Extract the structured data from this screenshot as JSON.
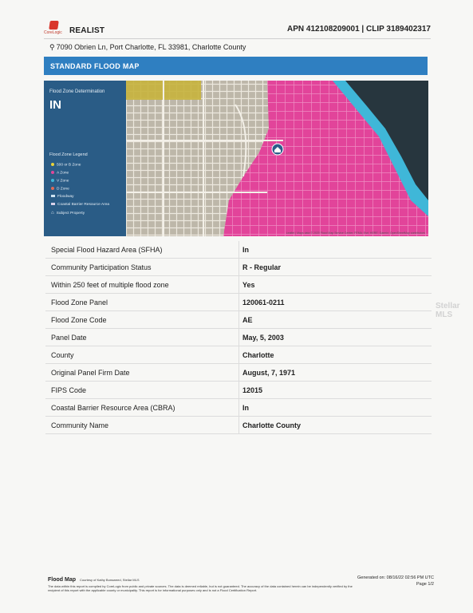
{
  "header": {
    "logo_text": "CoreLogic",
    "brand": "REALIST",
    "apn_clip": "APN 412108209001 | CLIP 3189402317"
  },
  "address": {
    "icon": "map-pin-icon",
    "text": "7090 Obrien Ln, Port Charlotte, FL 33981, Charlotte County"
  },
  "section": {
    "title": "STANDARD FLOOD MAP"
  },
  "map": {
    "determination_label": "Flood Zone Determination",
    "zone": "IN",
    "legend_title": "Flood Zone Legend",
    "legend": [
      {
        "label": "500 or B Zone",
        "color": "#e9d23a",
        "shape": "dot"
      },
      {
        "label": "A Zone",
        "color": "#e0479a",
        "shape": "dot"
      },
      {
        "label": "V Zone",
        "color": "#3fb7d8",
        "shape": "dot"
      },
      {
        "label": "D Zone",
        "color": "#e06a56",
        "shape": "dot"
      },
      {
        "label": "Floodway",
        "color": "#cfe3f1",
        "shape": "square"
      },
      {
        "label": "Coastal Barrier Resource Area",
        "color": "#d9d2ea",
        "shape": "square"
      },
      {
        "label": "Subject Property",
        "color": "#ffffff",
        "shape": "house"
      }
    ],
    "attribution": "Leaflet | Maps data © 2020 Flood Map Service Center; FEMA; Esri; HERE; Garmin; OpenStreetMap contributors",
    "colors": {
      "a_zone": "#e2449a",
      "b_zone": "#c6b33c",
      "v_zone": "#3fb7d8",
      "water": "#27363e",
      "land": "#c4bfb3"
    }
  },
  "rows": [
    {
      "label": "Special Flood Hazard Area (SFHA)",
      "value": "In"
    },
    {
      "label": "Community Participation Status",
      "value": "R - Regular"
    },
    {
      "label": "Within 250 feet of multiple flood zone",
      "value": "Yes"
    },
    {
      "label": "Flood Zone Panel",
      "value": "120061-0211"
    },
    {
      "label": "Flood Zone Code",
      "value": "AE"
    },
    {
      "label": "Panel Date",
      "value": "May, 5, 2003"
    },
    {
      "label": "County",
      "value": "Charlotte"
    },
    {
      "label": "Original Panel Firm Date",
      "value": "August, 7, 1971"
    },
    {
      "label": "FIPS Code",
      "value": "12015"
    },
    {
      "label": "Coastal Barrier Resource Area (CBRA)",
      "value": "In"
    },
    {
      "label": "Community Name",
      "value": "Charlotte County"
    }
  ],
  "watermark": "Stellar MLS",
  "footer": {
    "title": "Flood Map",
    "courtesy": "Courtesy of Kathy Bonsweed, Stellar MLS",
    "disclaimer": "The data within this report is compiled by CoreLogic from public and private sources. The data is deemed reliable, but is not guaranteed. The accuracy of the data contained herein can be independently verified by the recipient of this report with the applicable county or municipality. This report is for informational purposes only and is not a Flood Certification Report.",
    "generated": "Generated on: 08/16/22 02:56 PM UTC",
    "page": "Page 1/2"
  }
}
